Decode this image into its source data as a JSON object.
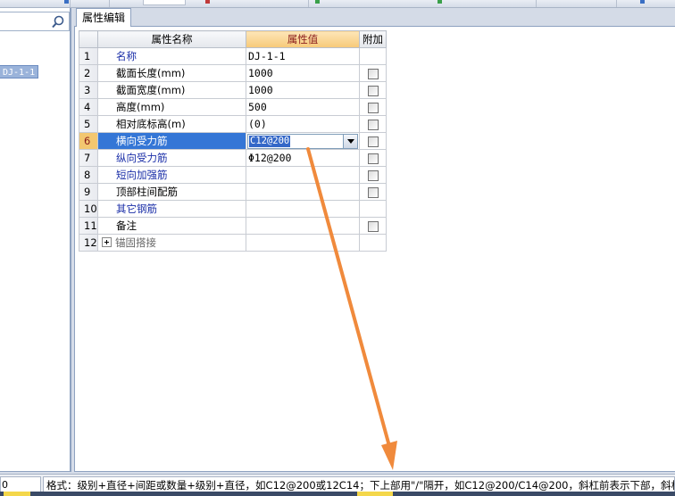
{
  "left_panel": {
    "search_placeholder": "",
    "tree_node": "DJ-1-1"
  },
  "tab": {
    "label": "属性编辑"
  },
  "grid": {
    "headers": {
      "num": "",
      "name": "属性名称",
      "value": "属性值",
      "attach": "附加"
    },
    "rows": [
      {
        "num": "1",
        "name": "名称",
        "value": "DJ-1-1",
        "attach": false,
        "blue": true
      },
      {
        "num": "2",
        "name": "截面长度(mm)",
        "value": "1000",
        "attach": true
      },
      {
        "num": "3",
        "name": "截面宽度(mm)",
        "value": "1000",
        "attach": true
      },
      {
        "num": "4",
        "name": "高度(mm)",
        "value": "500",
        "attach": true
      },
      {
        "num": "5",
        "name": "相对底标高(m)",
        "value": "(0)",
        "attach": true
      },
      {
        "num": "6",
        "name": "横向受力筋",
        "value": "C12@200",
        "attach": true,
        "selected": true
      },
      {
        "num": "7",
        "name": "纵向受力筋",
        "value": "Φ12@200",
        "attach": true,
        "blue": true
      },
      {
        "num": "8",
        "name": "短向加强筋",
        "value": "",
        "attach": true,
        "blue": true
      },
      {
        "num": "9",
        "name": "顶部柱间配筋",
        "value": "",
        "attach": true
      },
      {
        "num": "10",
        "name": "其它钢筋",
        "value": "",
        "attach": false,
        "blue": true
      },
      {
        "num": "11",
        "name": "备注",
        "value": "",
        "attach": true
      },
      {
        "num": "12",
        "name": "锚固搭接",
        "value": "",
        "attach": false,
        "gray": true,
        "expandable": true
      }
    ]
  },
  "status": {
    "left_value": "0",
    "format_text": "格式：级别+直径+间距或数量+级别+直径，如C12@200或12C14；下上部用\"/\"隔开，如C12@200/C14@200，斜杠前表示下部，斜杠后表示上部"
  },
  "colors": {
    "arrow": "#f08a3c",
    "selection": "#3476d6",
    "header_highlight": "#f7c978"
  }
}
